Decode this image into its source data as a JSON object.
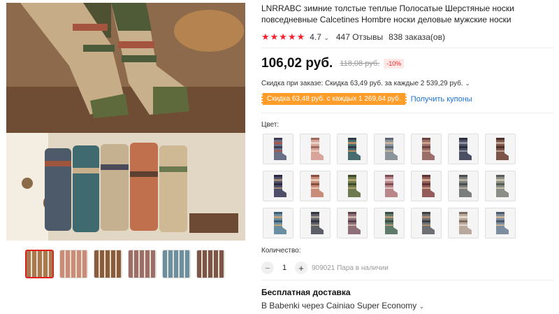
{
  "product": {
    "title": "LNRRABC зимние толстые теплые Полосатые Шерстяные носки повседневные Calcetines Hombre носки деловые мужские носки",
    "rating_stars": "★★★★★",
    "rating_value": "4.7",
    "reviews": "447 Отзывы",
    "orders": "838 заказа(ов)"
  },
  "price": {
    "current": "106,02 руб.",
    "old": "118,08 руб.",
    "discount": "-10%"
  },
  "order_discount": {
    "text": "Скидка при заказе: Скидка 63,49 руб. за каждые 2 539,29 руб."
  },
  "coupon": {
    "tag": "Скидка 63,48 руб. с каждых 1 269,64 руб.",
    "link": "Получить купоны"
  },
  "color": {
    "label": "Цвет:",
    "swatch_colors": [
      [
        "#6b6f86",
        "#3c3d52",
        "#a9564b"
      ],
      [
        "#d9a59a",
        "#9e6a63",
        "#e6d1c6"
      ],
      [
        "#476b6f",
        "#2f3a44",
        "#b88f64"
      ],
      [
        "#8b939c",
        "#5c6570",
        "#c7b49a"
      ],
      [
        "#9b6e6a",
        "#6a4540",
        "#c8a38b"
      ],
      [
        "#4a4f63",
        "#2c2f3d",
        "#8e8fa0"
      ],
      [
        "#7d5548",
        "#4d3029",
        "#bca08f"
      ],
      [
        "#4f4e6a",
        "#2c2b40",
        "#9f8a72"
      ],
      [
        "#c98c78",
        "#8b4f3f",
        "#e6cbb7"
      ],
      [
        "#6d7a4e",
        "#3f4a2b",
        "#b2a26e"
      ],
      [
        "#b9868a",
        "#7d4f55",
        "#e0c5c0"
      ],
      [
        "#935b59",
        "#5f3533",
        "#cfa488"
      ],
      [
        "#7a7f7d",
        "#4a4f4e",
        "#b9b2a1"
      ],
      [
        "#8a8e86",
        "#575c55",
        "#c8c0a8"
      ],
      [
        "#6a8fa3",
        "#3e5e70",
        "#c3a277"
      ],
      [
        "#5d5f68",
        "#34363d",
        "#a59b8d"
      ],
      [
        "#8f6f78",
        "#5a414a",
        "#c9b0a6"
      ],
      [
        "#5f7a69",
        "#3b4e41",
        "#b49772"
      ],
      [
        "#6e6f73",
        "#3d3e42",
        "#b38d6f"
      ],
      [
        "#b9a89c",
        "#7e6b5f",
        "#e3d7cc"
      ],
      [
        "#7c8da0",
        "#4b5a6c",
        "#c9b195"
      ]
    ]
  },
  "gallery": {
    "thumb_colors": [
      "#a8784f",
      "#c98c78",
      "#8a5c3c",
      "#9b6e6a",
      "#6a8fa3",
      "#7d5548"
    ]
  },
  "quantity": {
    "label": "Количество:",
    "minus": "−",
    "value": "1",
    "plus": "+",
    "stock": "909021 Пара в наличии"
  },
  "shipping": {
    "title": "Бесплатная доставка",
    "detail": "В Babenki через Cainiao Super Economy"
  },
  "icons": {
    "chevron": "chevron-down-icon",
    "star": "star-icon"
  }
}
